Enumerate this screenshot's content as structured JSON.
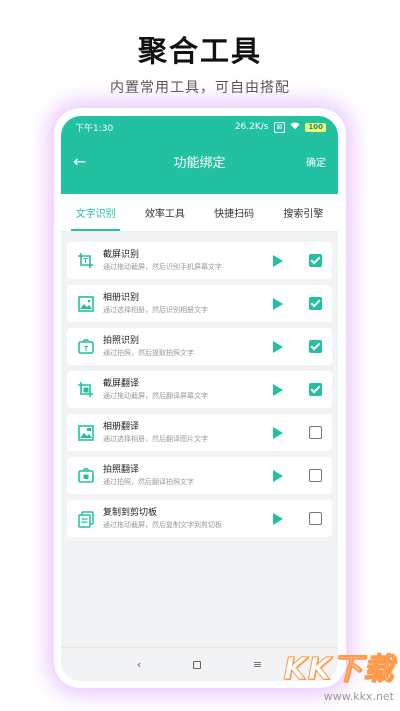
{
  "hero": {
    "title": "聚合工具",
    "subtitle": "内置常用工具，可自由搭配"
  },
  "status_bar": {
    "time": "下午1:30",
    "speed": "26.2K/s",
    "box_icon_label": "⊠",
    "battery": "100"
  },
  "toolbar": {
    "back_icon": "←",
    "title": "功能绑定",
    "confirm_label": "确定"
  },
  "tabs": [
    {
      "label": "文字识别",
      "active": true
    },
    {
      "label": "效率工具",
      "active": false
    },
    {
      "label": "快捷扫码",
      "active": false
    },
    {
      "label": "搜索引擎",
      "active": false
    }
  ],
  "items": [
    {
      "icon": "crop-text-icon",
      "title": "截屏识别",
      "desc": "通过拖动截屏，然后识别手机屏幕文字",
      "checked": true
    },
    {
      "icon": "album-image-icon",
      "title": "相册识别",
      "desc": "通过选择相册，然后识别相册文字",
      "checked": true
    },
    {
      "icon": "camera-text-icon",
      "title": "拍照识别",
      "desc": "通过拍照，然后提取拍照文字",
      "checked": true
    },
    {
      "icon": "crop-translate-icon",
      "title": "截屏翻译",
      "desc": "通过拖动截屏，然后翻译屏幕文字",
      "checked": true
    },
    {
      "icon": "album-translate-icon",
      "title": "相册翻译",
      "desc": "通过选择相册，然后翻译图片文字",
      "checked": false
    },
    {
      "icon": "camera-translate-icon",
      "title": "拍照翻译",
      "desc": "通过拍照，然后翻译拍照文字",
      "checked": false
    },
    {
      "icon": "copy-clipboard-icon",
      "title": "复制到剪切板",
      "desc": "通过拖动截屏，然后复制文字到剪切板",
      "checked": false
    }
  ],
  "navbar": {
    "back_glyph": "‹",
    "menu_glyph": "≡"
  },
  "watermark": {
    "logo": "KK下载",
    "url": "www.kkx.net"
  },
  "colors": {
    "accent": "#22c1a1",
    "glow": "#d696ff",
    "watermark_outline": "#ff9a4a"
  }
}
